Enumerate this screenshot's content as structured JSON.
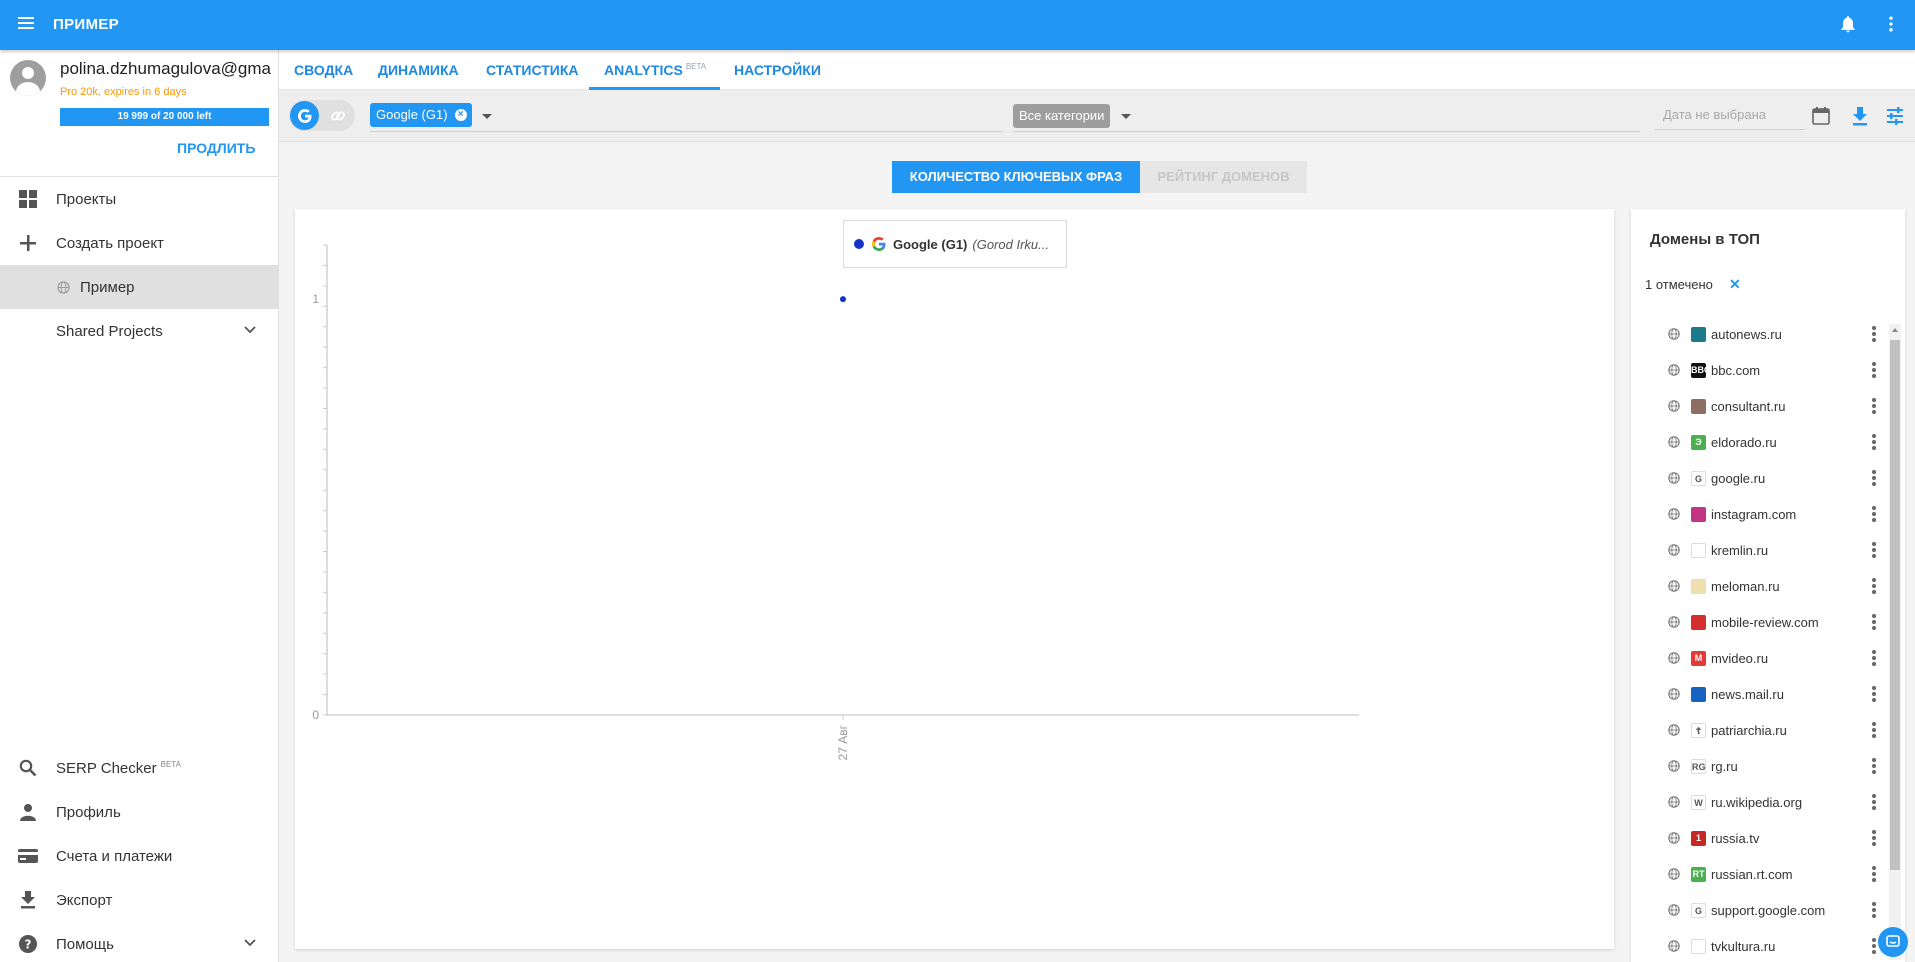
{
  "app": {
    "title": "ПРИМЕР",
    "accent": "#2196f3"
  },
  "user": {
    "email": "polina.dzhumagulova@gma",
    "plan": "Pro 20k, expires in 6 days",
    "quota": "19 999 of 20 000 left",
    "extend_label": "ПРОДЛИТЬ"
  },
  "sidebar": {
    "items": [
      {
        "label": "Проекты",
        "icon": "dashboard-icon"
      },
      {
        "label": "Создать проект",
        "icon": "plus-icon"
      },
      {
        "label": "Пример",
        "icon": "globe-icon"
      },
      {
        "label": "Shared Projects",
        "icon": "chevron-down-icon"
      }
    ],
    "bottom": [
      {
        "label": "SERP Checker",
        "badge": "BETA",
        "icon": "search-icon"
      },
      {
        "label": "Профиль",
        "icon": "person-icon"
      },
      {
        "label": "Счета и платежи",
        "icon": "credit-card-icon"
      },
      {
        "label": "Экспорт",
        "icon": "download-icon"
      },
      {
        "label": "Помощь",
        "icon": "help-icon"
      }
    ]
  },
  "tabs": [
    {
      "label": "СВОДКА"
    },
    {
      "label": "ДИНАМИКА"
    },
    {
      "label": "СТАТИСТИКА"
    },
    {
      "label": "ANALYTICS",
      "badge": "BETA",
      "active": true
    },
    {
      "label": "НАСТРОЙКИ"
    }
  ],
  "filters": {
    "engine_chip": "Google (G1)",
    "category": "Все категории",
    "date_placeholder": "Дата не выбрана"
  },
  "view_toggle": {
    "active": "КОЛИЧЕСТВО КЛЮЧЕВЫХ ФРАЗ",
    "inactive": "РЕЙТИНГ ДОМЕНОВ"
  },
  "chart_data": {
    "type": "scatter",
    "series": [
      {
        "name": "Google (G1)",
        "subtitle": "(Gorod Irku...",
        "color": "#1434c8",
        "points": [
          {
            "x": "27 Авг",
            "y": 1
          }
        ]
      }
    ],
    "x_ticks": [
      "27 Авг"
    ],
    "y_ticks": [
      0,
      1
    ],
    "ylim": [
      0,
      1.13
    ],
    "grid": false
  },
  "domains": {
    "title": "Домены в ТОП",
    "marked": "1 отмечено",
    "items": [
      {
        "name": "autonews.ru",
        "favicon": "autonews-favicon",
        "color": "#1d7a8c",
        "glyph": ""
      },
      {
        "name": "bbc.com",
        "favicon": "bbc-favicon",
        "color": "#111111",
        "glyph": "BBC"
      },
      {
        "name": "consultant.ru",
        "favicon": "consultant-favicon",
        "color": "#8d6e63",
        "glyph": ""
      },
      {
        "name": "eldorado.ru",
        "favicon": "eldorado-favicon",
        "color": "#4caf50",
        "glyph": "Э"
      },
      {
        "name": "google.ru",
        "favicon": "google-favicon",
        "color": "#ffffff",
        "glyph": "G"
      },
      {
        "name": "instagram.com",
        "favicon": "instagram-favicon",
        "color": "#c13584",
        "glyph": ""
      },
      {
        "name": "kremlin.ru",
        "favicon": "kremlin-favicon",
        "color": "#ffffff",
        "glyph": ""
      },
      {
        "name": "meloman.ru",
        "favicon": "meloman-favicon",
        "color": "#f0e0b0",
        "glyph": ""
      },
      {
        "name": "mobile-review.com",
        "favicon": "mobile-review-favicon",
        "color": "#d32f2f",
        "glyph": ""
      },
      {
        "name": "mvideo.ru",
        "favicon": "mvideo-favicon",
        "color": "#e53935",
        "glyph": "M"
      },
      {
        "name": "news.mail.ru",
        "favicon": "mail-favicon",
        "color": "#1565c0",
        "glyph": ""
      },
      {
        "name": "patriarchia.ru",
        "favicon": "patriarchia-favicon",
        "color": "#ffffff",
        "glyph": "☦"
      },
      {
        "name": "rg.ru",
        "favicon": "rg-favicon",
        "color": "#ffffff",
        "glyph": "RG"
      },
      {
        "name": "ru.wikipedia.org",
        "favicon": "wikipedia-favicon",
        "color": "#ffffff",
        "glyph": "W"
      },
      {
        "name": "russia.tv",
        "favicon": "russia-tv-favicon",
        "color": "#c62828",
        "glyph": "1"
      },
      {
        "name": "russian.rt.com",
        "favicon": "rt-favicon",
        "color": "#4caf50",
        "glyph": "RT"
      },
      {
        "name": "support.google.com",
        "favicon": "google-favicon",
        "color": "#ffffff",
        "glyph": "G"
      },
      {
        "name": "tvkultura.ru",
        "favicon": "tvkultura-favicon",
        "color": "#ffffff",
        "glyph": ""
      }
    ]
  }
}
